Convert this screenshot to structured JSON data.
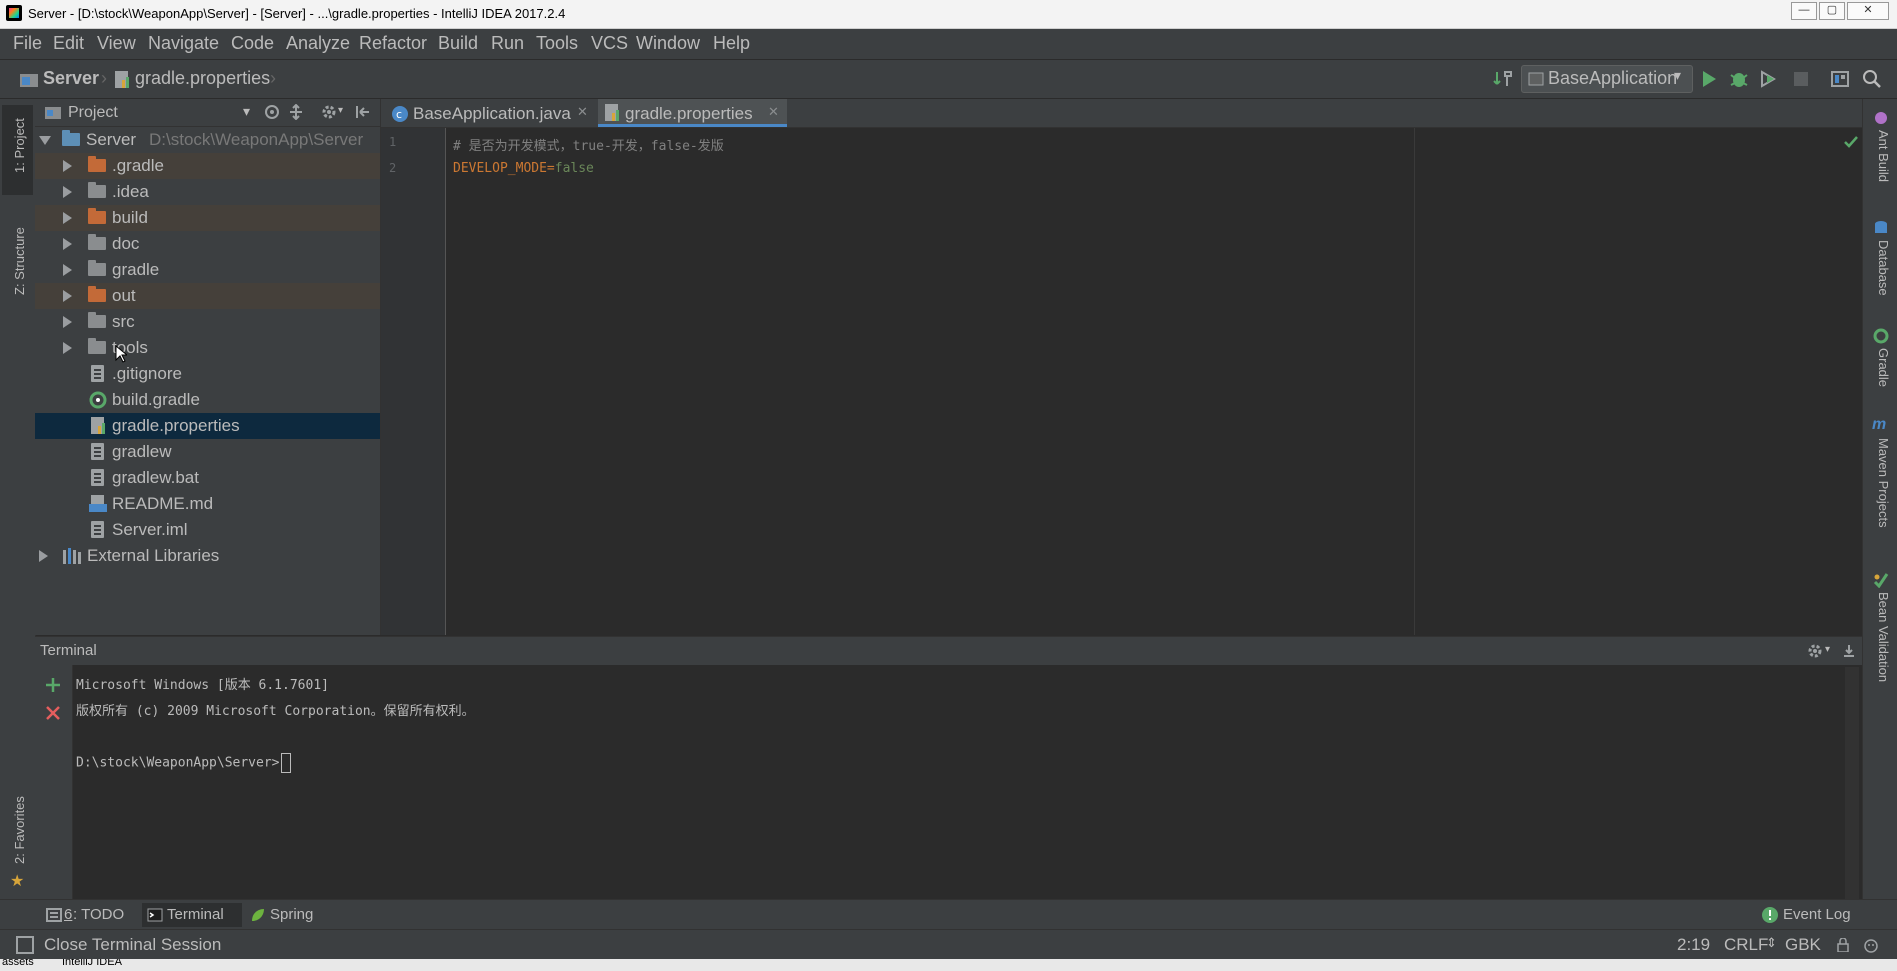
{
  "window": {
    "title": "Server - [D:\\stock\\WeaponApp\\Server] - [Server] - ...\\gradle.properties - IntelliJ IDEA 2017.2.4",
    "minimize": "—",
    "maximize": "▢",
    "close": "✕"
  },
  "menu": [
    "File",
    "Edit",
    "View",
    "Navigate",
    "Code",
    "Analyze",
    "Refactor",
    "Build",
    "Run",
    "Tools",
    "VCS",
    "Window",
    "Help"
  ],
  "breadcrumb": {
    "project": "Server",
    "file": "gradle.properties"
  },
  "toolbar": {
    "run_config": "BaseApplication"
  },
  "left_stripe": {
    "project": "1: Project",
    "structure": "Z: Structure",
    "favorites": "2: Favorites"
  },
  "right_stripe": [
    "Ant Build",
    "Database",
    "Gradle",
    "Maven Projects",
    "Bean Validation"
  ],
  "project_panel": {
    "title": "Project",
    "root_name": "Server",
    "root_path": "D:\\stock\\WeaponApp\\Server",
    "items": [
      {
        "name": ".gradle"
      },
      {
        "name": ".idea"
      },
      {
        "name": "build"
      },
      {
        "name": "doc"
      },
      {
        "name": "gradle"
      },
      {
        "name": "out"
      },
      {
        "name": "src"
      },
      {
        "name": "tools"
      },
      {
        "name": ".gitignore"
      },
      {
        "name": "build.gradle"
      },
      {
        "name": "gradle.properties"
      },
      {
        "name": "gradlew"
      },
      {
        "name": "gradlew.bat"
      },
      {
        "name": "README.md"
      },
      {
        "name": "Server.iml"
      }
    ],
    "external": "External Libraries"
  },
  "editor": {
    "tabs": [
      {
        "label": "BaseApplication.java"
      },
      {
        "label": "gradle.properties"
      }
    ],
    "lines": [
      {
        "num": "1",
        "comment": "# 是否为开发模式，true-开发，false-发版"
      },
      {
        "num": "2",
        "key": "DEVELOP_MODE",
        "eq": "=",
        "value": "false"
      }
    ]
  },
  "terminal": {
    "title": "Terminal",
    "lines": [
      "Microsoft Windows [版本 6.1.7601]",
      "版权所有 (c) 2009 Microsoft Corporation。保留所有权利。",
      "",
      "D:\\stock\\WeaponApp\\Server>"
    ]
  },
  "bottom_tabs": {
    "todo_num": "6",
    "todo": ": TODO",
    "terminal": "Terminal",
    "spring": "Spring",
    "event_log": "Event Log"
  },
  "status": {
    "message": "Close Terminal Session",
    "position": "2:19",
    "line_sep": "CRLF",
    "encoding": "GBK"
  },
  "taskbar": {
    "left": "assets",
    "right": "IntelliJ IDEA"
  },
  "colors": {
    "keyword_key": "#cc7832",
    "comment": "#808080",
    "value": "#6a8759",
    "selection": "#0d293e",
    "run_green": "#59a869"
  }
}
